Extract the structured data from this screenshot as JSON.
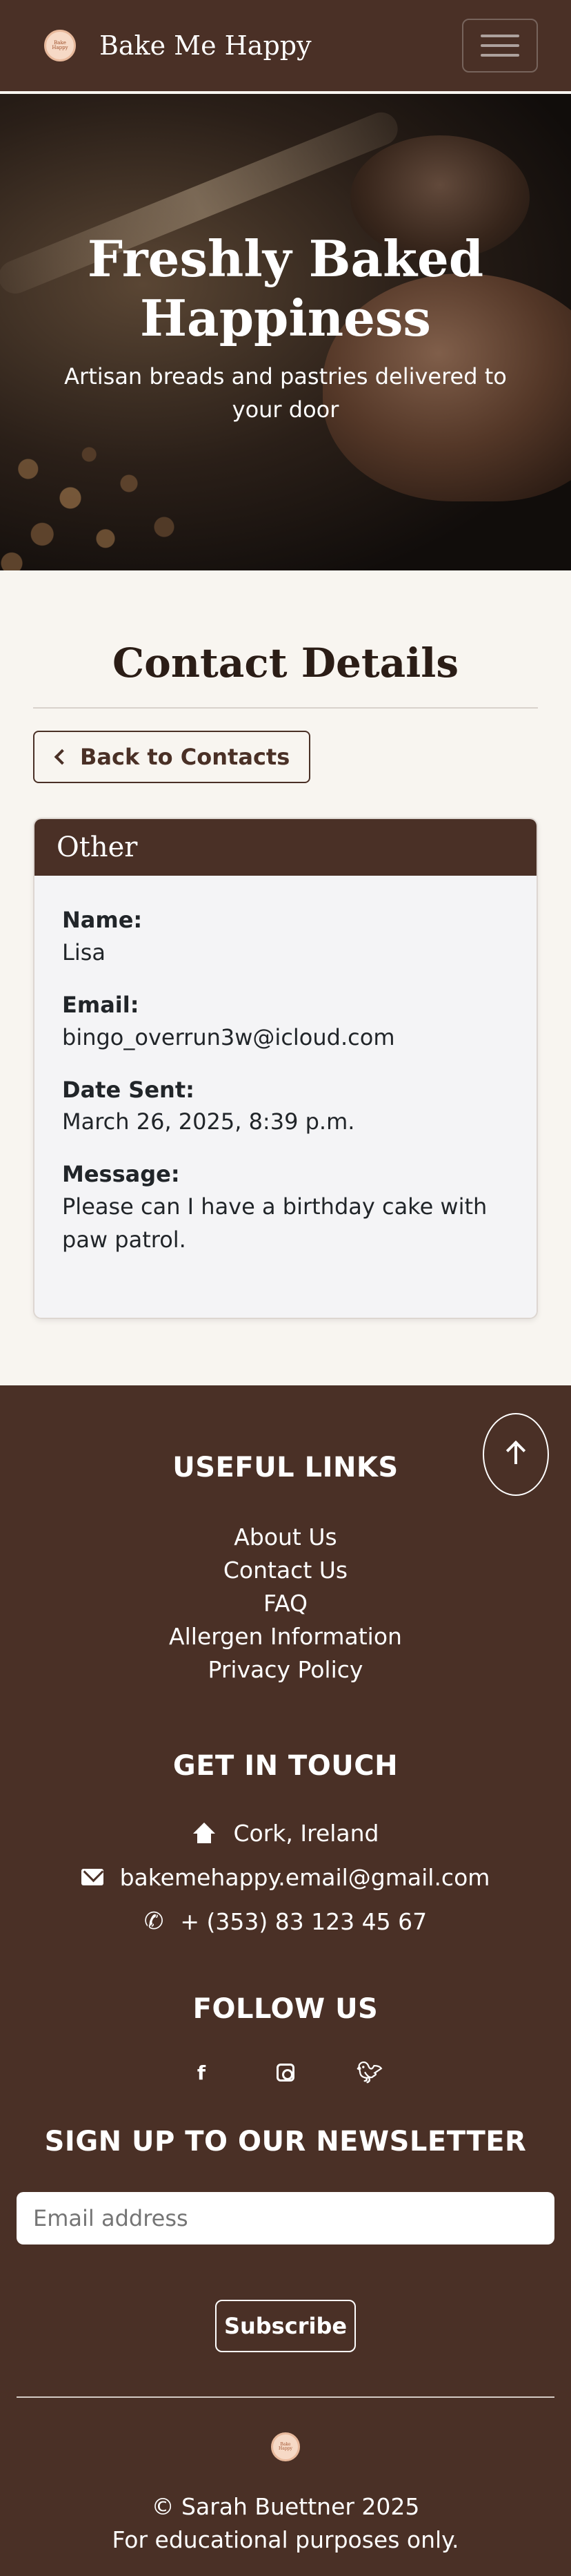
{
  "nav": {
    "brand": "Bake Me Happy",
    "logo_text": "Bake Me Happy"
  },
  "hero": {
    "title": "Freshly Baked Happiness",
    "subtitle": "Artisan breads and pastries delivered to your door"
  },
  "main": {
    "title": "Contact Details",
    "back_label": "Back to Contacts",
    "card": {
      "header": "Other",
      "fields": [
        {
          "label": "Name:",
          "value": "Lisa"
        },
        {
          "label": "Email:",
          "value": "bingo_overrun3w@icloud.com"
        },
        {
          "label": "Date Sent:",
          "value": "March 26, 2025, 8:39 p.m."
        },
        {
          "label": "Message:",
          "value": "Please can I have a birthday cake with paw patrol."
        }
      ]
    }
  },
  "footer": {
    "useful_links_heading": "USEFUL LINKS",
    "links": [
      "About Us",
      "Contact Us",
      "FAQ",
      "Allergen Information",
      "Privacy Policy"
    ],
    "get_in_touch_heading": "GET IN TOUCH",
    "location": "Cork, Ireland",
    "email": "bakemehappy.email@gmail.com",
    "phone": "+ (353) 83 123 45 67",
    "follow_heading": "FOLLOW US",
    "socials": [
      "facebook-icon",
      "instagram-icon",
      "twitter-icon"
    ],
    "newsletter_heading": "SIGN UP TO OUR NEWSLETTER",
    "email_placeholder": "Email address",
    "subscribe_label": "Subscribe",
    "copyright": "© Sarah Buettner 2025",
    "disclaimer": "For educational purposes only."
  }
}
